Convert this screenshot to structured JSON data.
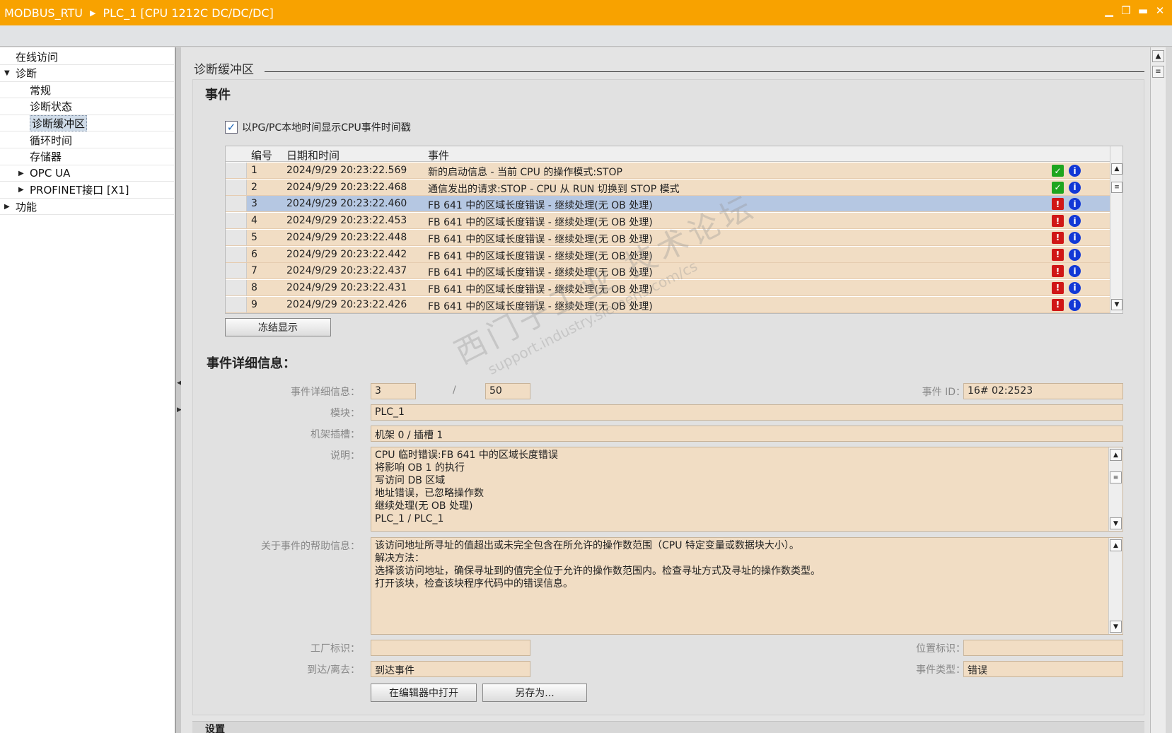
{
  "window": {
    "project": "MODBUS_RTU",
    "device": "PLC_1 [CPU 1212C DC/DC/DC]"
  },
  "nav": {
    "items": [
      {
        "label": "在线访问",
        "indent": 0,
        "arrow": ""
      },
      {
        "label": "诊断",
        "indent": 0,
        "arrow": "▼"
      },
      {
        "label": "常规",
        "indent": 1,
        "arrow": ""
      },
      {
        "label": "诊断状态",
        "indent": 1,
        "arrow": ""
      },
      {
        "label": "诊断缓冲区",
        "indent": 1,
        "arrow": "",
        "selected": true
      },
      {
        "label": "循环时间",
        "indent": 1,
        "arrow": ""
      },
      {
        "label": "存储器",
        "indent": 1,
        "arrow": ""
      },
      {
        "label": "OPC UA",
        "indent": 1,
        "arrow": "▶"
      },
      {
        "label": "PROFINET接口 [X1]",
        "indent": 1,
        "arrow": "▶"
      },
      {
        "label": "功能",
        "indent": 0,
        "arrow": "▶"
      }
    ]
  },
  "section": {
    "title": "诊断缓冲区"
  },
  "events": {
    "heading": "事件",
    "checkbox_label": "以PG/PC本地时间显示CPU事件时间戳",
    "checkbox_checked": true,
    "columns": {
      "num": "编号",
      "datetime": "日期和时间",
      "event": "事件"
    },
    "rows": [
      {
        "num": "1",
        "datetime": "2024/9/29 20:23:22.569",
        "event": "新的启动信息 - 当前 CPU 的操作模式:STOP",
        "status": "ok"
      },
      {
        "num": "2",
        "datetime": "2024/9/29 20:23:22.468",
        "event": "通信发出的请求:STOP - CPU 从 RUN 切换到 STOP 模式",
        "status": "ok"
      },
      {
        "num": "3",
        "datetime": "2024/9/29 20:23:22.460",
        "event": "FB 641 中的区域长度错误 - 继续处理(无 OB 处理)",
        "status": "error",
        "selected": true
      },
      {
        "num": "4",
        "datetime": "2024/9/29 20:23:22.453",
        "event": "FB 641 中的区域长度错误 - 继续处理(无 OB 处理)",
        "status": "error"
      },
      {
        "num": "5",
        "datetime": "2024/9/29 20:23:22.448",
        "event": "FB 641 中的区域长度错误 - 继续处理(无 OB 处理)",
        "status": "error"
      },
      {
        "num": "6",
        "datetime": "2024/9/29 20:23:22.442",
        "event": "FB 641 中的区域长度错误 - 继续处理(无 OB 处理)",
        "status": "error"
      },
      {
        "num": "7",
        "datetime": "2024/9/29 20:23:22.437",
        "event": "FB 641 中的区域长度错误 - 继续处理(无 OB 处理)",
        "status": "error"
      },
      {
        "num": "8",
        "datetime": "2024/9/29 20:23:22.431",
        "event": "FB 641 中的区域长度错误 - 继续处理(无 OB 处理)",
        "status": "error"
      },
      {
        "num": "9",
        "datetime": "2024/9/29 20:23:22.426",
        "event": "FB 641 中的区域长度错误 - 继续处理(无 OB 处理)",
        "status": "error"
      }
    ],
    "freeze_button": "冻结显示"
  },
  "details": {
    "heading": "事件详细信息：",
    "detail_label": "事件详细信息：",
    "detail_index": "3",
    "detail_separator": "/",
    "detail_total": "50",
    "event_id_label": "事件 ID：",
    "event_id": "16# 02:2523",
    "module_label": "模块：",
    "module": "PLC_1",
    "rack_label": "机架插槽：",
    "rack": "机架 0 / 插槽 1",
    "desc_label": "说明：",
    "description": [
      "CPU 临时错误:FB 641 中的区域长度错误",
      "将影响 OB 1 的执行",
      "写访问 DB 区域",
      "地址错误，已忽略操作数",
      " 继续处理(无 OB 处理)",
      "PLC_1 / PLC_1"
    ],
    "help_label": "关于事件的帮助信息：",
    "help": [
      "该访问地址所寻址的值超出或未完全包含在所允许的操作数范围（CPU 特定变量或数据块大小）。",
      "解决方法：",
      "选择该访问地址，确保寻址到的值完全位于允许的操作数范围内。检查寻址方式及寻址的操作数类型。",
      "打开该块，检查该块程序代码中的错误信息。"
    ],
    "plant_label": "工厂标识：",
    "plant": "",
    "location_label": "位置标识：",
    "location": "",
    "arrive_label": "到达/离去：",
    "arrive": "到达事件",
    "type_label": "事件类型：",
    "type": "错误",
    "open_button": "在编辑器中打开",
    "saveas_button": "另存为..."
  },
  "bottom_tab": "设置",
  "watermark": {
    "line1": "西门子工业 技术论坛",
    "line2": "support.industry.siemens.com/cs"
  }
}
